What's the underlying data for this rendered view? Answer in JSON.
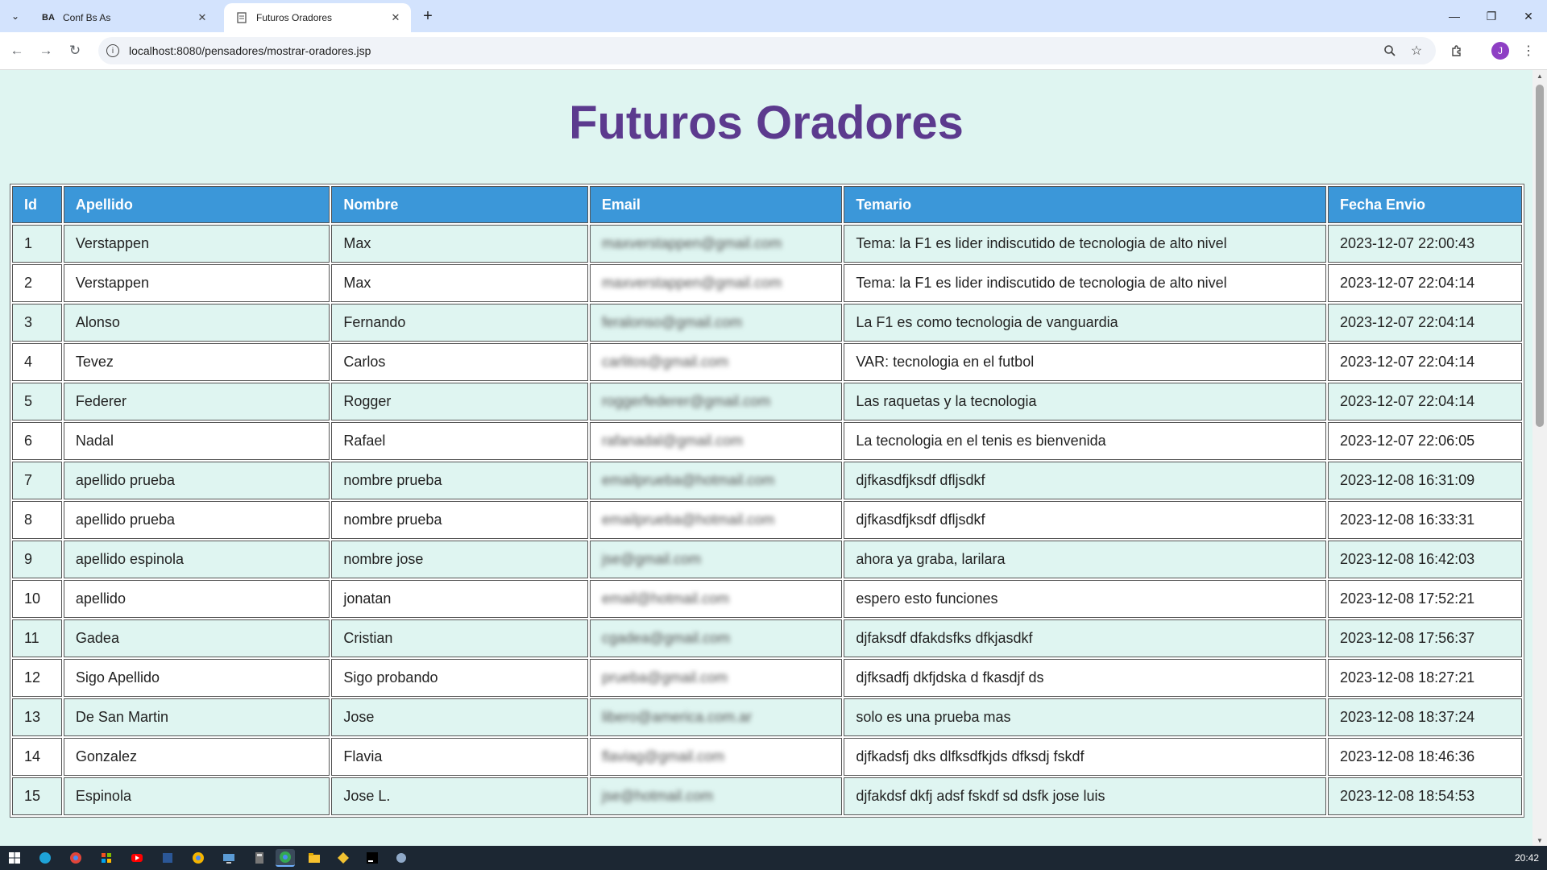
{
  "browser": {
    "tabs": [
      {
        "title": "Conf Bs As",
        "favicon": "BA"
      },
      {
        "title": "Futuros Oradores",
        "favicon": "page-icon"
      }
    ],
    "url": "localhost:8080/pensadores/mostrar-oradores.jsp",
    "profile_initial": "J"
  },
  "page": {
    "heading": "Futuros Oradores",
    "columns": [
      "Id",
      "Apellido",
      "Nombre",
      "Email",
      "Temario",
      "Fecha Envio"
    ],
    "rows": [
      [
        "1",
        "Verstappen",
        "Max",
        "maxverstappen@gmail.com",
        "Tema: la F1 es lider indiscutido de tecnologia de alto nivel",
        "2023-12-07 22:00:43"
      ],
      [
        "2",
        "Verstappen",
        "Max",
        "maxverstappen@gmail.com",
        "Tema: la F1 es lider indiscutido de tecnologia de alto nivel",
        "2023-12-07 22:04:14"
      ],
      [
        "3",
        "Alonso",
        "Fernando",
        "feralonso@gmail.com",
        "La F1 es como tecnologia de vanguardia",
        "2023-12-07 22:04:14"
      ],
      [
        "4",
        "Tevez",
        "Carlos",
        "carlitos@gmail.com",
        "VAR: tecnologia en el futbol",
        "2023-12-07 22:04:14"
      ],
      [
        "5",
        "Federer",
        "Rogger",
        "roggerfederer@gmail.com",
        "Las raquetas y la tecnologia",
        "2023-12-07 22:04:14"
      ],
      [
        "6",
        "Nadal",
        "Rafael",
        "rafanadal@gmail.com",
        "La tecnologia en el tenis es bienvenida",
        "2023-12-07 22:06:05"
      ],
      [
        "7",
        "apellido prueba",
        "nombre prueba",
        "emailprueba@hotmail.com",
        "djfkasdfjksdf dfljsdkf",
        "2023-12-08 16:31:09"
      ],
      [
        "8",
        "apellido prueba",
        "nombre prueba",
        "emailprueba@hotmail.com",
        "djfkasdfjksdf dfljsdkf",
        "2023-12-08 16:33:31"
      ],
      [
        "9",
        "apellido espinola",
        "nombre jose",
        "jse@gmail.com",
        "ahora ya graba, larilara",
        "2023-12-08 16:42:03"
      ],
      [
        "10",
        "apellido",
        "jonatan",
        "email@hotmail.com",
        "espero esto funciones",
        "2023-12-08 17:52:21"
      ],
      [
        "11",
        "Gadea",
        "Cristian",
        "cgadea@gmail.com",
        "djfaksdf dfakdsfks dfkjasdkf",
        "2023-12-08 17:56:37"
      ],
      [
        "12",
        "Sigo Apellido",
        "Sigo probando",
        "prueba@gmail.com",
        "djfksadfj dkfjdska d fkasdjf ds",
        "2023-12-08 18:27:21"
      ],
      [
        "13",
        "De San Martin",
        "Jose",
        "libero@america.com.ar",
        "solo es una prueba mas",
        "2023-12-08 18:37:24"
      ],
      [
        "14",
        "Gonzalez",
        "Flavia",
        "flaviag@gmail.com",
        "djfkadsfj dks dlfksdfkjds dfksdj fskdf",
        "2023-12-08 18:46:36"
      ],
      [
        "15",
        "Espinola",
        "Jose L.",
        "jse@hotmail.com",
        "djfakdsf dkfj adsf fskdf sd dsfk jose luis",
        "2023-12-08 18:54:53"
      ]
    ]
  },
  "taskbar": {
    "clock": "20:42",
    "apps": [
      "start-icon",
      "edge-icon",
      "chrome-icon",
      "store-icon",
      "youtube-icon",
      "app-icon",
      "chrome-icon",
      "remote-desktop-icon",
      "calculator-icon",
      "chrome-active-icon",
      "file-explorer-icon",
      "git-icon",
      "intellij-icon",
      "tool-icon"
    ]
  },
  "colors": {
    "page_bg": "#dff5f1",
    "header_bg": "#3b97d9",
    "heading_color": "#5c3a8e",
    "tabstrip_bg": "#d3e3fd"
  }
}
